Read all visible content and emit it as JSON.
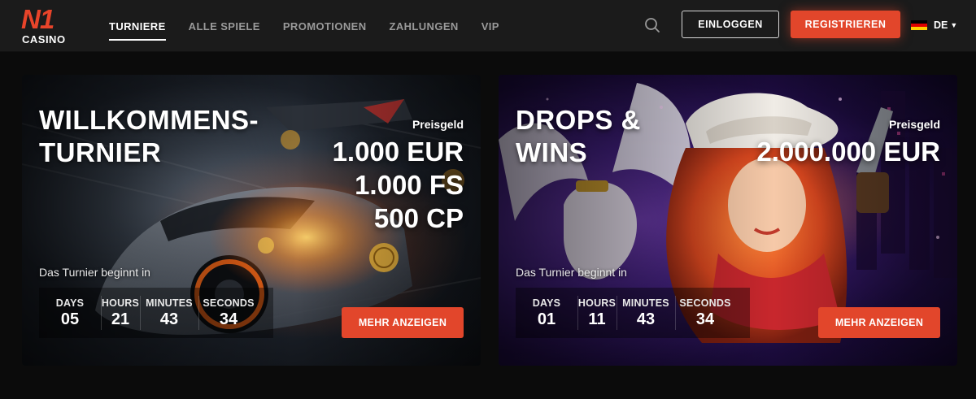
{
  "header": {
    "logo": {
      "main": "N1",
      "sub": "CASINO"
    },
    "nav": [
      {
        "label": "TURNIERE",
        "active": true
      },
      {
        "label": "ALLE SPIELE",
        "active": false
      },
      {
        "label": "PROMOTIONEN",
        "active": false
      },
      {
        "label": "ZAHLUNGEN",
        "active": false
      },
      {
        "label": "VIP",
        "active": false
      }
    ],
    "search_icon": "search-icon",
    "login_label": "EINLOGGEN",
    "register_label": "REGISTRIEREN",
    "language": {
      "code": "DE",
      "flag": "germany-flag-icon",
      "flag_colors": [
        "#000000",
        "#dd0000",
        "#ffce00"
      ]
    }
  },
  "colors": {
    "accent": "#e2462b",
    "header_bg": "#1b1b1b",
    "page_bg": "#0b0b0b"
  },
  "tournaments": [
    {
      "title_line1": "WILLKOMMENS-",
      "title_line2": "TURNIER",
      "prize_label": "Preisgeld",
      "prizes": [
        "1.000 EUR",
        "1.000 FS",
        "500 CP"
      ],
      "starts_label": "Das Turnier beginnt in",
      "countdown": {
        "days_label": "DAYS",
        "days": "05",
        "hours_label": "HOURS",
        "hours": "21",
        "minutes_label": "MINUTES",
        "minutes": "43",
        "seconds_label": "SECONDS",
        "seconds": "34"
      },
      "button_label": "MEHR ANZEIGEN"
    },
    {
      "title_line1": "DROPS &",
      "title_line2": "WINS",
      "prize_label": "Preisgeld",
      "prizes": [
        "2.000.000 EUR"
      ],
      "starts_label": "Das Turnier beginnt in",
      "countdown": {
        "days_label": "DAYS",
        "days": "01",
        "hours_label": "HOURS",
        "hours": "11",
        "minutes_label": "MINUTES",
        "minutes": "43",
        "seconds_label": "SECONDS",
        "seconds": "34"
      },
      "button_label": "MEHR ANZEIGEN"
    }
  ]
}
